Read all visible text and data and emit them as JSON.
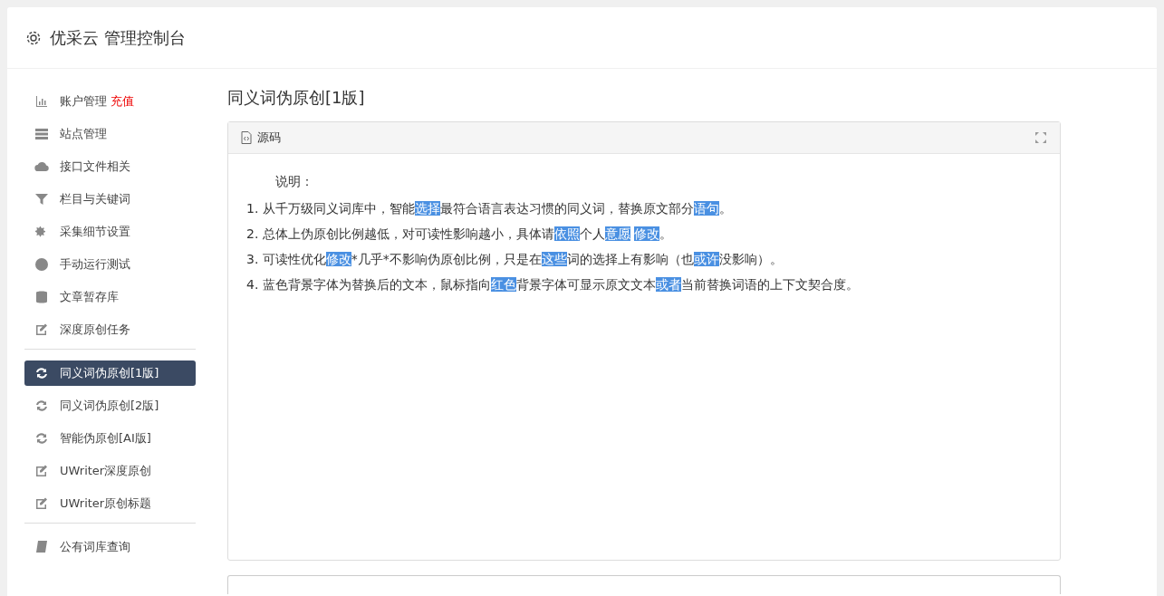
{
  "header": {
    "title": "优采云 管理控制台"
  },
  "sidebar": {
    "groups": [
      [
        {
          "label": "账户管理",
          "badge": "充值",
          "selected": false
        },
        {
          "label": "站点管理",
          "selected": false
        },
        {
          "label": "接口文件相关",
          "selected": false
        },
        {
          "label": "栏目与关键词",
          "selected": false
        },
        {
          "label": "采集细节设置",
          "selected": false
        },
        {
          "label": "手动运行测试",
          "selected": false
        },
        {
          "label": "文章暂存库",
          "selected": false
        },
        {
          "label": "深度原创任务",
          "selected": false
        }
      ],
      [
        {
          "label": "同义词伪原创[1版]",
          "selected": true
        },
        {
          "label": "同义词伪原创[2版]",
          "selected": false
        },
        {
          "label": "智能伪原创[AI版]",
          "selected": false
        },
        {
          "label": "UWriter深度原创",
          "selected": false
        },
        {
          "label": "UWriter原创标题",
          "selected": false
        }
      ],
      [
        {
          "label": "公有词库查询",
          "selected": false
        }
      ]
    ]
  },
  "content": {
    "title": "同义词伪原创[1版]",
    "panel": {
      "tab": "源码",
      "heading": "说明：",
      "lines": [
        [
          {
            "text": "1. 从千万级同义词库中，智能",
            "highlighted": false
          },
          {
            "text": "选择",
            "highlighted": true
          },
          {
            "text": "最符合语言表达习惯的同义词，替换原文部分",
            "highlighted": false
          },
          {
            "text": "语句",
            "highlighted": true
          },
          {
            "text": "。",
            "highlighted": false
          }
        ],
        [
          {
            "text": "2. 总体上伪原创比例越低，对可读性影响越小，具体请",
            "highlighted": false
          },
          {
            "text": "依照",
            "highlighted": true
          },
          {
            "text": "个人",
            "highlighted": false
          },
          {
            "text": "意愿",
            "highlighted": true
          },
          {
            "text": "修改",
            "highlighted": true
          },
          {
            "text": "。",
            "highlighted": false
          }
        ],
        [
          {
            "text": "3. 可读性优化",
            "highlighted": false
          },
          {
            "text": "修改",
            "highlighted": true
          },
          {
            "text": "*几乎*不影响伪原创比例，只是在",
            "highlighted": false
          },
          {
            "text": "这些",
            "highlighted": true
          },
          {
            "text": "词的选择上有影响（也",
            "highlighted": false
          },
          {
            "text": "或许",
            "highlighted": true
          },
          {
            "text": "没影响）。",
            "highlighted": false
          }
        ],
        [
          {
            "text": "4. 蓝色背景字体为替换后的文本，鼠标指向",
            "highlighted": false
          },
          {
            "text": "红色",
            "highlighted": true
          },
          {
            "text": "背景字体可显示原文文本",
            "highlighted": false
          },
          {
            "text": "或者",
            "highlighted": true
          },
          {
            "text": "当前替换词语的上下文契合度。",
            "highlighted": false
          }
        ]
      ]
    }
  }
}
